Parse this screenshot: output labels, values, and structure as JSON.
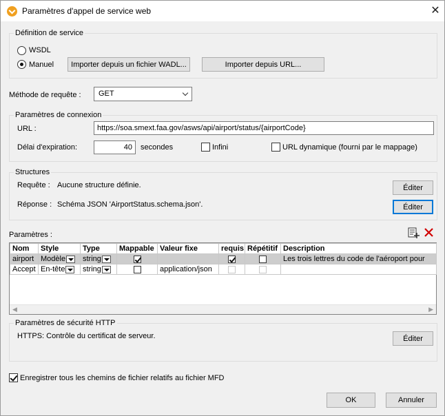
{
  "window": {
    "title": "Paramètres d'appel de service web",
    "close": "✕"
  },
  "service_definition": {
    "legend": "Définition de service",
    "wsdl_label": "WSDL",
    "manual_label": "Manuel",
    "manual_selected": true,
    "import_wadl_button": "Importer depuis un fichier WADL...",
    "import_url_button": "Importer depuis URL..."
  },
  "request_method": {
    "label": "Méthode de requête :",
    "value": "GET"
  },
  "connection": {
    "legend": "Paramètres de connexion",
    "url_label": "URL :",
    "url_value": "https://soa.smext.faa.gov/asws/api/airport/status/{airportCode}",
    "timeout_label": "Délai d'expiration:",
    "timeout_value": "40",
    "timeout_unit": "secondes",
    "infinite_label": "Infini",
    "dynamic_url_label": "URL dynamique (fourni par le mappage)"
  },
  "structures": {
    "legend": "Structures",
    "request_label": "Requête :",
    "request_value": "Aucune structure définie.",
    "response_label": "Réponse :",
    "response_value": "Schéma JSON 'AirportStatus.schema.json'.",
    "edit_request_button": "Éditer",
    "edit_response_button": "Éditer"
  },
  "parameters": {
    "label": "Paramètres :",
    "add_icon": "add-parameter-icon",
    "delete_icon": "delete-icon",
    "columns": [
      "Nom",
      "Style",
      "Type",
      "Mappable",
      "Valeur fixe",
      "requis",
      "Répétitif",
      "Description"
    ],
    "rows": [
      {
        "name": "airport",
        "style": "Modèle",
        "type": "string",
        "mappable": true,
        "fixed": "",
        "required": true,
        "repeating": false,
        "description": "Les trois lettres du code de l'aéroport pour"
      },
      {
        "name": "Accept",
        "style": "En-tête",
        "type": "string",
        "mappable": false,
        "fixed": "application/json",
        "required": false,
        "repeating": false,
        "description": ""
      }
    ]
  },
  "http_security": {
    "legend": "Paramètres de sécurité HTTP",
    "value": "HTTPS: Contrôle du certificat de serveur.",
    "edit_button": "Éditer"
  },
  "save_relative": {
    "label": "Enregistrer tous les chemins de fichier relatifs au fichier MFD",
    "checked": true
  },
  "footer": {
    "ok": "OK",
    "cancel": "Annuler"
  },
  "colors": {
    "accent": "#0078d7",
    "delete": "#d00000",
    "selected_row": "#cdcdcd"
  }
}
